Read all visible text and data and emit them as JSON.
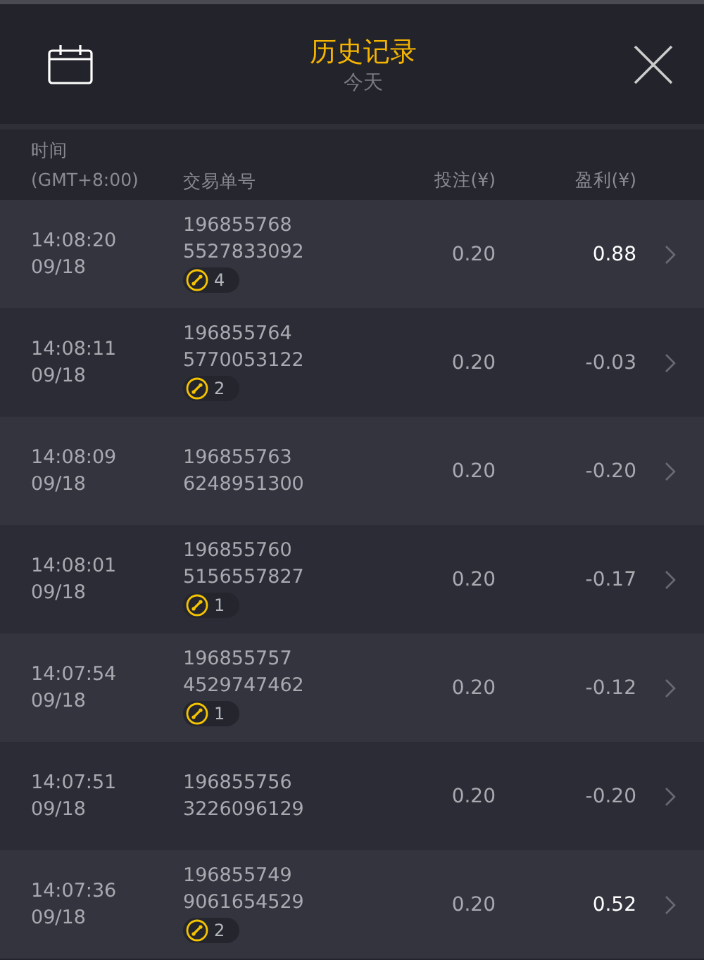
{
  "header": {
    "title": "历史记录",
    "subtitle": "今天"
  },
  "columns": [
    {
      "lines": [
        "时间",
        "(GMT+8:00)"
      ]
    },
    {
      "lines": [
        "交易单号"
      ]
    },
    {
      "lines": [
        "投注(¥)"
      ]
    },
    {
      "lines": [
        "盈利(¥)"
      ]
    }
  ],
  "rows": [
    {
      "time": "14:08:20",
      "date": "09/18",
      "order_1": "196855768",
      "order_2": "5527833092",
      "badge": "4",
      "stake": "0.20",
      "profit": "0.88",
      "positive": true
    },
    {
      "time": "14:08:11",
      "date": "09/18",
      "order_1": "196855764",
      "order_2": "5770053122",
      "badge": "2",
      "stake": "0.20",
      "profit": "-0.03",
      "positive": false
    },
    {
      "time": "14:08:09",
      "date": "09/18",
      "order_1": "196855763",
      "order_2": "6248951300",
      "stake": "0.20",
      "profit": "-0.20",
      "positive": false
    },
    {
      "time": "14:08:01",
      "date": "09/18",
      "order_1": "196855760",
      "order_2": "5156557827",
      "badge": "1",
      "stake": "0.20",
      "profit": "-0.17",
      "positive": false
    },
    {
      "time": "14:07:54",
      "date": "09/18",
      "order_1": "196855757",
      "order_2": "4529747462",
      "badge": "1",
      "stake": "0.20",
      "profit": "-0.12",
      "positive": false
    },
    {
      "time": "14:07:51",
      "date": "09/18",
      "order_1": "196855756",
      "order_2": "3226096129",
      "stake": "0.20",
      "profit": "-0.20",
      "positive": false
    },
    {
      "time": "14:07:36",
      "date": "09/18",
      "order_1": "196855749",
      "order_2": "9061654529",
      "badge": "2",
      "stake": "0.20",
      "profit": "0.52",
      "positive": true
    }
  ]
}
